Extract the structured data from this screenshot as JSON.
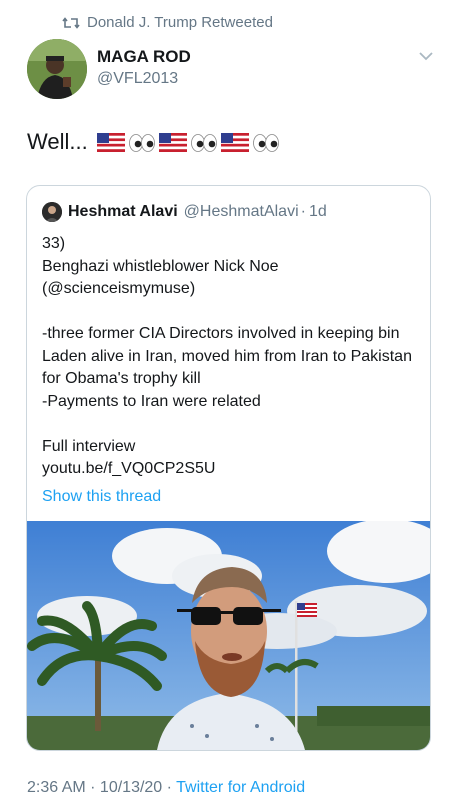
{
  "retweet": {
    "label": "Donald J. Trump Retweeted",
    "icon": "retweet-icon"
  },
  "author": {
    "name": "MAGA ROD",
    "handle": "@VFL2013"
  },
  "tweet": {
    "text": "Well..."
  },
  "quoted": {
    "name": "Heshmat Alavi",
    "handle": "@HeshmatAlavi",
    "sep": "·",
    "time": "1d",
    "body": "33)\nBenghazi whistleblower Nick Noe\n(@scienceismymuse)\n\n-three former CIA Directors involved in keeping bin Laden alive in Iran, moved him from Iran to Pakistan for Obama's trophy kill\n-Payments to Iran were related\n\nFull interview\nyoutu.be/f_VQ0CP2S5U",
    "show_thread": "Show this thread"
  },
  "footer": {
    "timestamp": "2:36 AM · 10/13/20 · ",
    "source": "Twitter for Android"
  },
  "colors": {
    "link": "#1da1f2",
    "muted": "#657786",
    "border": "#ccd6dd"
  }
}
